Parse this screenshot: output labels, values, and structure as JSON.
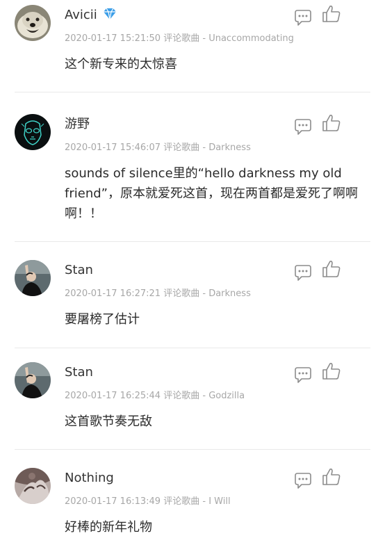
{
  "comments": [
    {
      "username": "Avicii",
      "badge_icon": "diamond-icon",
      "timestamp": "2020-01-17 15:21:50",
      "action": "评论歌曲",
      "song": "Unaccommodating",
      "text": "这个新专来的太惊喜"
    },
    {
      "username": "游野",
      "timestamp": "2020-01-17 15:46:07",
      "action": "评论歌曲",
      "song": "Darkness",
      "text": "sounds of silence里的“hello darkness my old friend”，原本就爱死这首，现在两首都是爱死了啊啊啊！！"
    },
    {
      "username": "Stan",
      "timestamp": "2020-01-17 16:27:21",
      "action": "评论歌曲",
      "song": "Darkness",
      "text": "要屠榜了估计"
    },
    {
      "username": "Stan",
      "timestamp": "2020-01-17 16:25:44",
      "action": "评论歌曲",
      "song": "Godzilla",
      "text": "这首歌节奏无敌"
    },
    {
      "username": "Nothing",
      "timestamp": "2020-01-17 16:13:49",
      "action": "评论歌曲",
      "song": "I Will",
      "text": "好棒的新年礼物"
    }
  ],
  "icons": {
    "reply": "speech-bubble-icon",
    "like": "thumbs-up-icon"
  },
  "colors": {
    "username": "#333333",
    "meta": "#a7a7a7",
    "divider": "#e9e9e9",
    "badge": "#3b9ee8"
  }
}
